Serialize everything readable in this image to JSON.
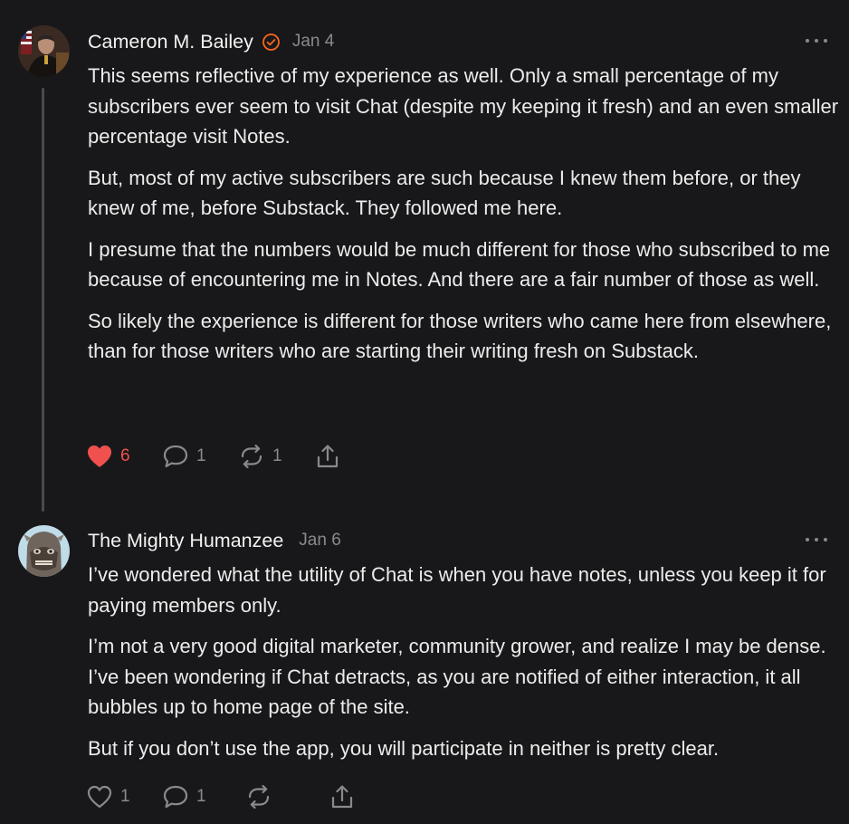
{
  "comments": [
    {
      "author": "Cameron M. Bailey",
      "verified": true,
      "date": "Jan 4",
      "paragraphs": [
        "This seems reflective of my experience as well. Only a small percentage of my subscribers ever seem to visit Chat (despite my keeping it fresh) and an even smaller percentage visit Notes.",
        "But, most of my active subscribers are such because I knew them before, or they knew of me, before Substack. They followed me here.",
        "I presume that the numbers would be much different for those who subscribed to me because of encountering me in Notes. And there are a fair number of those as well.",
        "So likely the experience is different for those writers who came here from elsewhere, than for those writers who are starting their writing fresh on Substack."
      ],
      "likes": "6",
      "liked": true,
      "replies": "1",
      "restacks": "1"
    },
    {
      "author": "The Mighty Humanzee",
      "verified": false,
      "date": "Jan 6",
      "paragraphs": [
        "I’ve wondered what the utility of Chat is when you have notes, unless you keep it for paying members only.",
        "I’m not a very good digital marketer, community grower, and realize I may be dense. I’ve been wondering if Chat detracts, as you are notified of either interaction, it all bubbles up to home page of the site.",
        "But if you don’t use the app, you will participate in neither is pretty clear."
      ],
      "likes": "1",
      "liked": false,
      "replies": "1",
      "restacks": ""
    }
  ],
  "colors": {
    "background": "#18181a",
    "text": "#ececec",
    "muted": "#8a8a8e",
    "like_active": "#f0514f",
    "verified_badge": "#ff6719"
  }
}
